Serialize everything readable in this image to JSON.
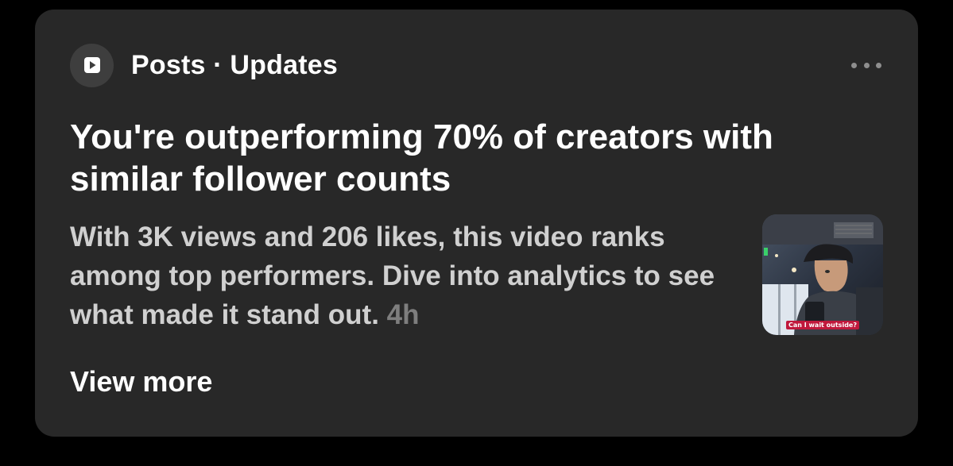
{
  "header": {
    "app_icon": "play-square-icon",
    "title": "Posts · Updates",
    "more_icon": "more-horizontal-icon"
  },
  "notification": {
    "headline": "You're outperforming 70% of creators with similar follower counts",
    "body": "With 3K views and 206 likes, this video ranks among top performers. Dive into analytics to see what made it stand out.",
    "timestamp": "4h",
    "thumbnail_caption": "Can I wait outside?",
    "view_more_label": "View more"
  },
  "colors": {
    "page_bg": "#000000",
    "card_bg": "#282828",
    "icon_circle_bg": "#3e3e3e",
    "primary_text": "#ffffff",
    "secondary_text": "#d0d0d0",
    "muted_text": "#7e7e7e"
  }
}
